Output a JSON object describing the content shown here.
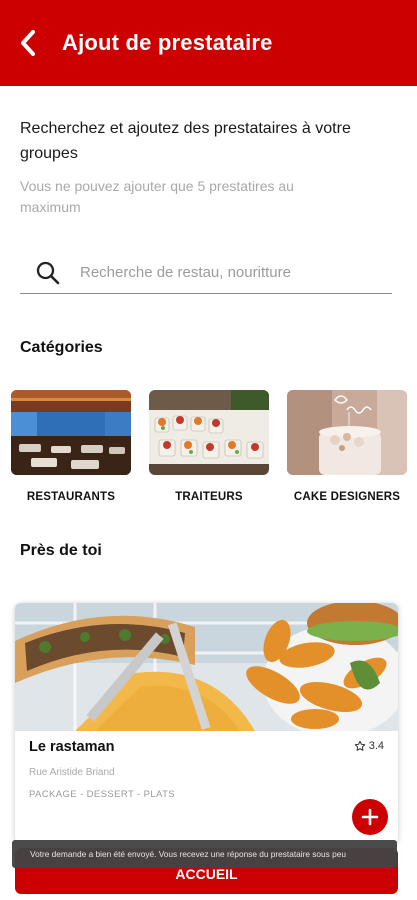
{
  "header": {
    "title": "Ajout de prestataire",
    "background": "#cc0000"
  },
  "intro": {
    "text": "Recherchez et ajoutez des prestataires à votre groupes",
    "hint": "Vous ne pouvez ajouter que 5 prestatires au maximum"
  },
  "search": {
    "placeholder": "Recherche de restau, nouritture",
    "value": "",
    "icon": "search-icon"
  },
  "categories": {
    "title": "Catégories",
    "items": [
      {
        "label": "RESTAURANTS",
        "image": "restaurant-dining-room"
      },
      {
        "label": "TRAITEURS",
        "image": "catering-buffet"
      },
      {
        "label": "CAKE DESIGNERS",
        "image": "decorated-cake"
      }
    ]
  },
  "nearby": {
    "title": "Près de toi",
    "card": {
      "name": "Le rastaman",
      "rating": "3.4",
      "address": "Rue Aristide Briand",
      "tags": "PACKAGE - DESSERT - PLATS",
      "image": "food-plate-sandwich-potatoes"
    }
  },
  "footer": {
    "button_label": "ACCUEIL"
  },
  "snackbar": {
    "text": "Votre demande a bien été envoyé. Vous recevez une réponse du prestataire sous peu"
  },
  "colors": {
    "accent": "#cc0000",
    "muted_text": "#a9a9a9"
  }
}
